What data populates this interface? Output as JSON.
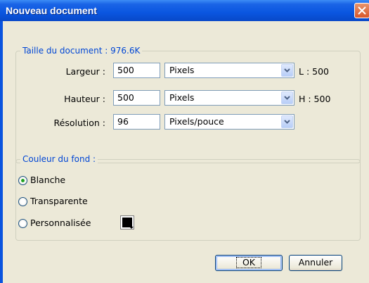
{
  "window": {
    "title": "Nouveau document"
  },
  "size_group": {
    "legend": "Taille du document : 976.6K",
    "width": {
      "label": "Largeur :",
      "value": "500",
      "unit": "Pixels",
      "side": "L : 500"
    },
    "height": {
      "label": "Hauteur :",
      "value": "500",
      "unit": "Pixels",
      "side": "H : 500"
    },
    "resolution": {
      "label": "Résolution :",
      "value": "96",
      "unit": "Pixels/pouce"
    }
  },
  "background_group": {
    "legend": "Couleur du fond :",
    "options": [
      {
        "label": "Blanche",
        "selected": true
      },
      {
        "label": "Transparente",
        "selected": false
      },
      {
        "label": "Personnalisée",
        "selected": false
      }
    ],
    "custom_color": "#000000"
  },
  "buttons": {
    "ok": "OK",
    "cancel": "Annuler"
  },
  "colors": {
    "titlebar": "#0a56e0",
    "dialog_bg": "#ece9d8",
    "legend_text": "#0046d5",
    "radio_dot": "#21a121"
  }
}
